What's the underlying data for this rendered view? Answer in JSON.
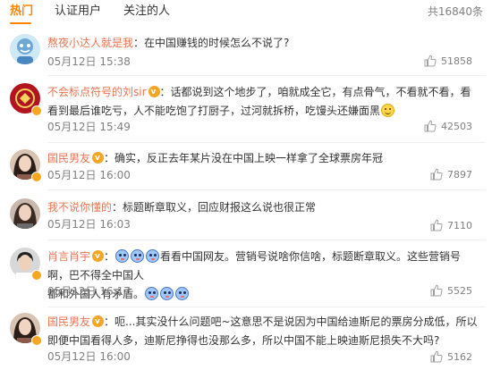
{
  "tabs": [
    {
      "label": "热门",
      "active": true
    },
    {
      "label": "认证用户",
      "active": false
    },
    {
      "label": "关注的人",
      "active": false
    }
  ],
  "total_count": "共16840条",
  "colors": {
    "accent": "#ff8200",
    "username": "#eb7350",
    "meta": "#808080",
    "text": "#333333",
    "verified": "#f5a623"
  },
  "comments": [
    {
      "username": "熬夜小达人就是我",
      "verified": false,
      "text": "：在中国赚钱的时候怎么不说了?",
      "time": "05月12日 15:38",
      "likes": "51858",
      "avatar": "avatar-cartoon"
    },
    {
      "username": "不会标点符号的刘sir",
      "verified": true,
      "text": "：话都说到这个地步了，咱就成全它，有点骨气，不看就不看，看看到最后谁吃亏，人不能吃饱了打厨子，过河就拆桥，吃馒头还嫌面黑",
      "emoji": "smile-emoji",
      "time": "05月12日 15:49",
      "likes": "42503",
      "avatar": "avatar-logo"
    },
    {
      "username": "国民男友",
      "verified": true,
      "text": "：确实，反正去年某片没在中国上映一样拿了全球票房年冠",
      "time": "05月12日 16:00",
      "likes": "7897",
      "avatar": "avatar-woman"
    },
    {
      "username": "我不说你懂的",
      "verified": false,
      "text": "：标题断章取义，回应财报这么说也很正常",
      "time": "05月12日 16:03",
      "likes": "7110",
      "avatar": "avatar-woman"
    },
    {
      "username": "肖言肖宇",
      "verified": true,
      "text_line1": "看看中国网友。营销号说啥你信啥，标题断章取义。这些营销号啊，巴不得全中国人",
      "text_line2": "都和外国人有矛盾。",
      "time": "05月12日 16:17",
      "likes": "5525",
      "avatar": "avatar-man"
    },
    {
      "username": "国民男友",
      "verified": true,
      "text": "：呃...其实没什么问题吧~这意思不是说因为中国给迪斯尼的票房分成低，所以即便中国看得人多，迪斯尼挣得也没那么多，所以中国不能上映迪斯尼损失不大吗?",
      "time": "05月12日 16:00",
      "likes": "5162",
      "avatar": "avatar-woman"
    }
  ]
}
